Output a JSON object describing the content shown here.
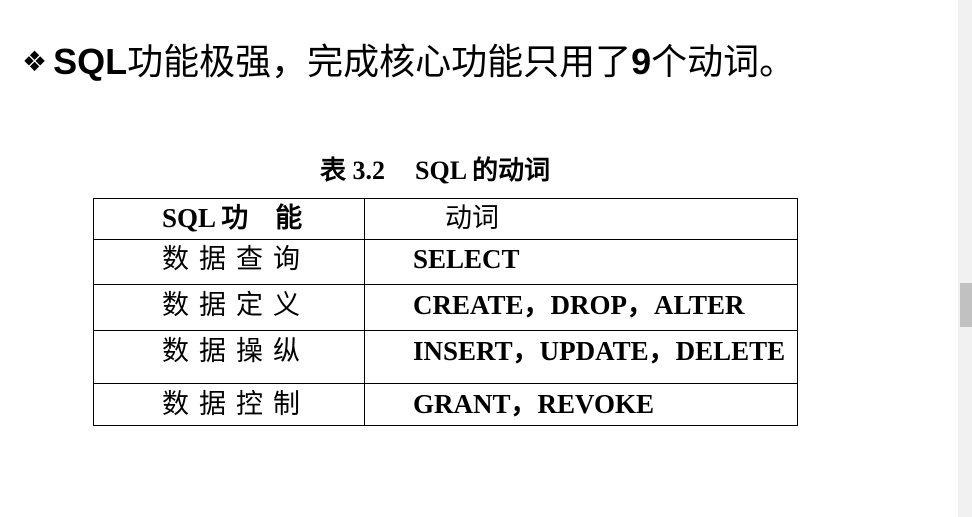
{
  "heading": {
    "bullet": "❖",
    "part1": "SQL",
    "part2": "功能极强，完成核心功能只用了",
    "part3": "9",
    "part4": "个动词。"
  },
  "table": {
    "caption_label": "表 3.2",
    "caption_title": "SQL 的动词",
    "header": {
      "col1": "SQL 功　能",
      "col2": "动词"
    },
    "rows": [
      {
        "function": "数据查询",
        "verbs": "SELECT"
      },
      {
        "function": "数据定义",
        "verbs": "CREATE，DROP，ALTER"
      },
      {
        "function": "数据操纵",
        "verbs": "INSERT，UPDATE，DELETE"
      },
      {
        "function": "数据控制",
        "verbs": "GRANT，REVOKE"
      }
    ]
  }
}
